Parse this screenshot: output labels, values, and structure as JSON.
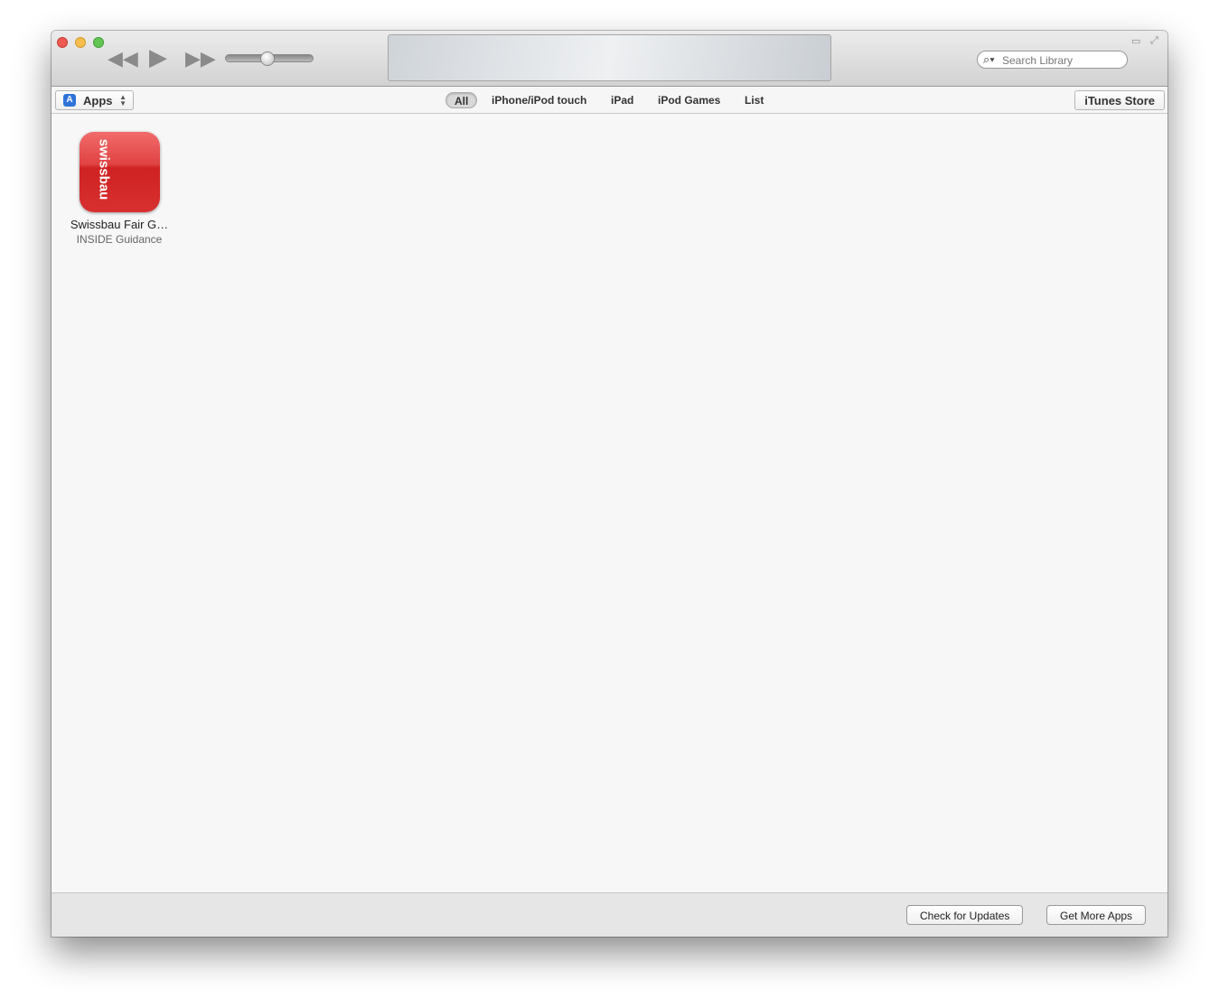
{
  "toolbar": {
    "search_placeholder": "Search Library",
    "volume_percent": 48
  },
  "nav": {
    "selector_label": "Apps",
    "tabs": [
      "All",
      "iPhone/iPod touch",
      "iPad",
      "iPod Games",
      "List"
    ],
    "selected_tab": "All",
    "store_label": "iTunes Store"
  },
  "apps": [
    {
      "icon_text": "swissbau",
      "name": "Swissbau Fair G…",
      "developer": "INSIDE Guidance"
    }
  ],
  "footer": {
    "check_updates": "Check for Updates",
    "get_more": "Get More Apps"
  }
}
